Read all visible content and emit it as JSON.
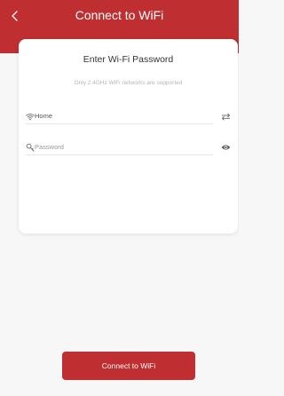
{
  "header": {
    "title": "Connect to WiFi",
    "background_color": "#bf2e31",
    "back_icon": "chevron-left-icon"
  },
  "card": {
    "title": "Enter Wi-Fi Password",
    "subtitle": "Only 2.4GHz WiFi networks are supported"
  },
  "network_field": {
    "value": "Home",
    "icon": "wifi-icon",
    "action_icon": "switch-network-icon"
  },
  "password_field": {
    "placeholder": "Password",
    "value": "",
    "icon": "key-icon",
    "action_icon": "eye-icon"
  },
  "footer": {
    "connect_label": "Connect to WiFi",
    "button_color": "#bf2e31"
  }
}
